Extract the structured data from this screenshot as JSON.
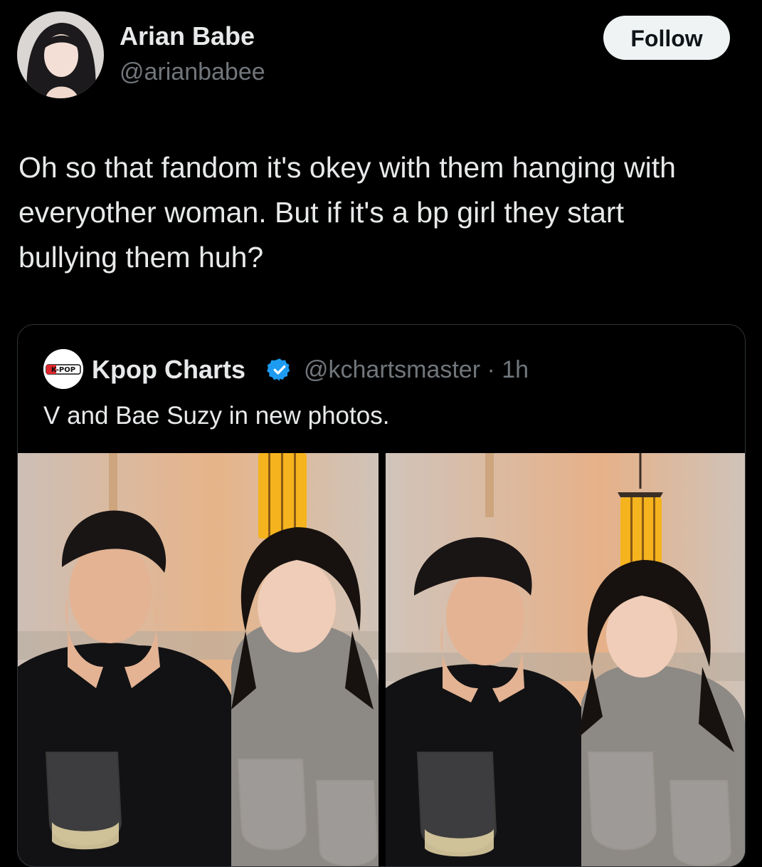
{
  "author": {
    "name": "Arian Babe",
    "handle": "@arianbabee"
  },
  "follow_label": "Follow",
  "tweet": {
    "text": "Oh so that fandom it's okey with them hanging with everyother woman. But if it's a bp girl they start bullying them huh?"
  },
  "quoted": {
    "avatar_text": "K-POP",
    "name": "Kpop Charts",
    "meta": "@kchartsmaster · 1h",
    "text": "V and Bae Suzy in new photos.",
    "photos": [
      "photo-1",
      "photo-2"
    ]
  },
  "icons": {
    "verified": "verified-badge-icon"
  },
  "colors": {
    "background": "#000000",
    "text_primary": "#e7e9ea",
    "text_secondary": "#71767b",
    "border": "#2f3336",
    "verified": "#1d9bf0",
    "follow_bg": "#eff3f4"
  }
}
